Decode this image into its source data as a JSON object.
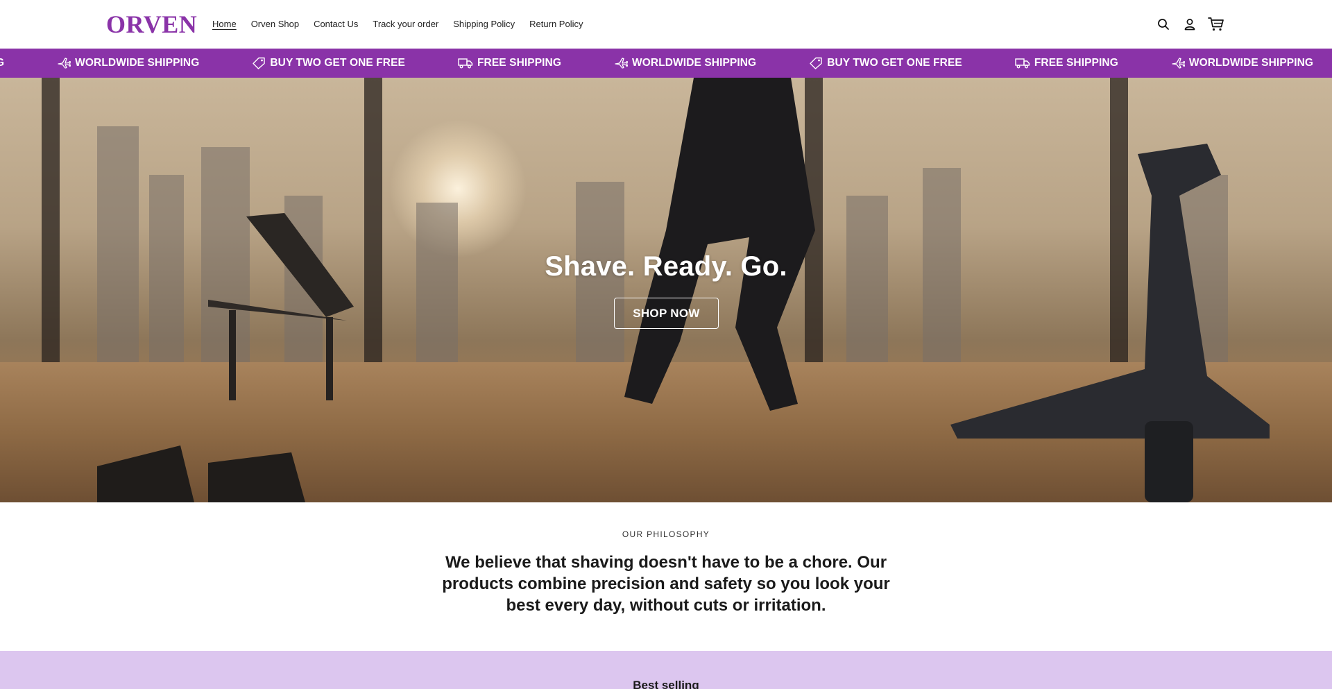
{
  "header": {
    "logo": "ORVEN",
    "nav": [
      {
        "label": "Home",
        "active": true
      },
      {
        "label": "Orven Shop"
      },
      {
        "label": "Contact Us"
      },
      {
        "label": "Track your order"
      },
      {
        "label": "Shipping Policy"
      },
      {
        "label": "Return Policy"
      }
    ],
    "icons": [
      "search-icon",
      "account-icon",
      "cart-icon"
    ]
  },
  "marquee": {
    "partial_text": "G",
    "items": [
      {
        "icon": "plane-icon",
        "text": "WORLDWIDE SHIPPING"
      },
      {
        "icon": "tag-icon",
        "text": "BUY TWO GET ONE FREE"
      },
      {
        "icon": "truck-icon",
        "text": "FREE SHIPPING"
      },
      {
        "icon": "plane-icon",
        "text": "WORLDWIDE SHIPPING"
      },
      {
        "icon": "tag-icon",
        "text": "BUY TWO GET ONE FREE"
      },
      {
        "icon": "truck-icon",
        "text": "FREE SHIPPING"
      },
      {
        "icon": "plane-icon",
        "text": "WORLDWIDE SHIPPING"
      }
    ]
  },
  "hero": {
    "title": "Shave. Ready. Go.",
    "button": "SHOP NOW"
  },
  "philosophy": {
    "eyebrow": "OUR PHILOSOPHY",
    "text": "We believe that shaving doesn't have to be a chore. Our products combine precision and safety so you look your best every day, without cuts or irritation."
  },
  "best_selling": {
    "title": "Best selling"
  },
  "colors": {
    "brand": "#8a33a8",
    "best_selling_bg": "#dcc6ef"
  }
}
